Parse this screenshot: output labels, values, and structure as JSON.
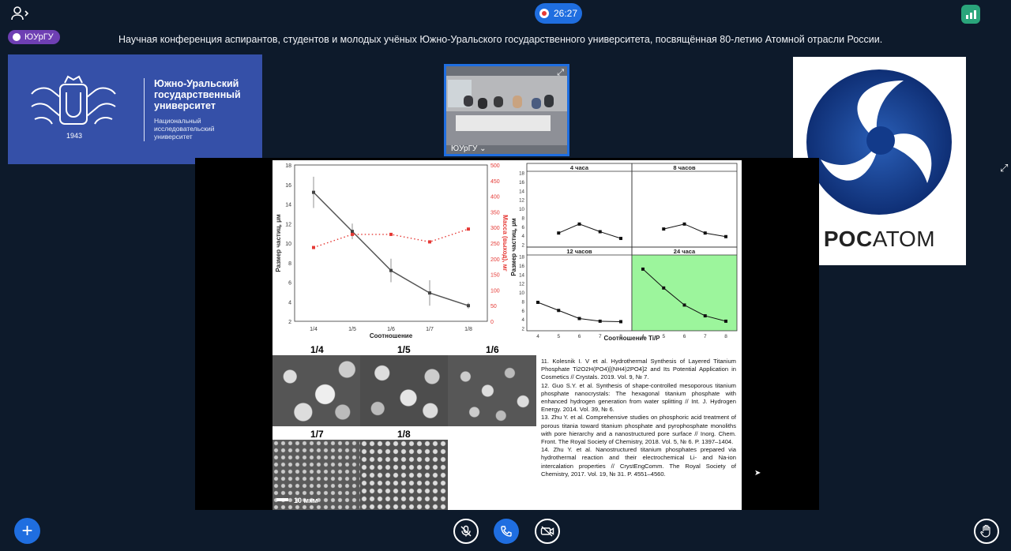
{
  "call": {
    "timer": "26:27",
    "badge_label": "ЮУрГУ",
    "conference_title": "Научная конференция аспирантов, студентов и молодых учёных Южно-Уральского государственного университета, посвящённая 80-летию Атомной отрасли России."
  },
  "logos": {
    "susu_name": "Южно-Уральский государственный университет",
    "susu_sub": "Национальный исследовательский университет",
    "susu_year": "1943",
    "rosatom_text_bold": "РОС",
    "rosatom_text_thin": "АТОМ"
  },
  "video": {
    "label": "ЮУрГУ ⌄"
  },
  "slide": {
    "refs": "11. Kolesnik I. V et al. Hydrothermal Synthesis of Layered Titanium Phosphate Ti2O2H(PO4)[(NH4)2PO4]2 and Its Potential Application in Cosmetics // Crystals. 2019. Vol. 9, № 7.\n12. Guo S.Y. et al. Synthesis of shape-controlled mesoporous titanium phosphate nanocrystals: The hexagonal titanium phosphate with enhanced hydrogen generation from water splitting // Int. J. Hydrogen Energy. 2014. Vol. 39, № 6.\n13. Zhu Y. et al. Comprehensive studies on phosphoric acid treatment of porous titania toward titanium phosphate and pyrophosphate monoliths with pore hierarchy and a nanostructured pore surface // Inorg. Chem. Front. The Royal Society of Chemistry, 2018. Vol. 5, № 6. P. 1397–1404.\n14. Zhu Y. et al. Nanostructured titanium phosphates prepared via hydrothermal reaction and their electrochemical Li- and Na-ion intercalation properties // CrystEngComm. The Royal Society of Chemistry, 2017. Vol. 19, № 31. P. 4551–4560.",
    "sem_labels": [
      "1/4",
      "1/5",
      "1/6",
      "1/7",
      "1/8"
    ],
    "scale": "10 мкм"
  },
  "chart_data": [
    {
      "type": "line",
      "categories": [
        "1/4",
        "1/5",
        "1/6",
        "1/7",
        "1/8"
      ],
      "xlabel": "Соотношение",
      "ylabel": "Размер частиц, µм",
      "y2label": "Масса (выход), мг",
      "ylim": [
        2,
        18
      ],
      "yticks": [
        2,
        4,
        6,
        8,
        10,
        12,
        14,
        16,
        18
      ],
      "y2lim": [
        0,
        500
      ],
      "y2ticks": [
        0,
        50,
        100,
        150,
        200,
        250,
        300,
        350,
        400,
        450,
        500
      ],
      "series": [
        {
          "values": [
            15.2,
            11.2,
            7.2,
            4.9,
            3.6
          ],
          "errors": [
            1.6,
            0.8,
            1.2,
            1.3,
            0.3
          ],
          "color": "#555555",
          "axis": "left"
        },
        {
          "values": [
            236,
            278,
            278,
            254,
            295
          ],
          "color": "#e53935",
          "axis": "right",
          "style": "dotted"
        }
      ]
    },
    {
      "type": "line",
      "xlabel": "Соотношение Ti/P",
      "ylabel": "Размер частиц, µм",
      "ylim": [
        2,
        18
      ],
      "yticks": [
        2,
        4,
        6,
        8,
        10,
        12,
        14,
        16,
        18
      ],
      "xticks": [
        4,
        5,
        6,
        7,
        8
      ],
      "panels": [
        {
          "title": "4 часа",
          "x": [
            5,
            6,
            7,
            8
          ],
          "values": [
            4.6,
            6.6,
            4.9,
            3.4
          ],
          "highlight": false
        },
        {
          "title": "8 часов",
          "x": [
            5,
            6,
            7,
            8
          ],
          "values": [
            5.5,
            6.6,
            4.6,
            3.8
          ],
          "highlight": false
        },
        {
          "title": "12 часов",
          "x": [
            4,
            5,
            6,
            7,
            8
          ],
          "values": [
            7.8,
            6.0,
            4.2,
            3.6,
            3.5
          ],
          "highlight": false
        },
        {
          "title": "24 часа",
          "x": [
            4,
            5,
            6,
            7,
            8
          ],
          "values": [
            15.2,
            11.0,
            7.2,
            4.8,
            3.6
          ],
          "highlight": true,
          "highlight_color": "#9cf59c"
        }
      ]
    }
  ]
}
